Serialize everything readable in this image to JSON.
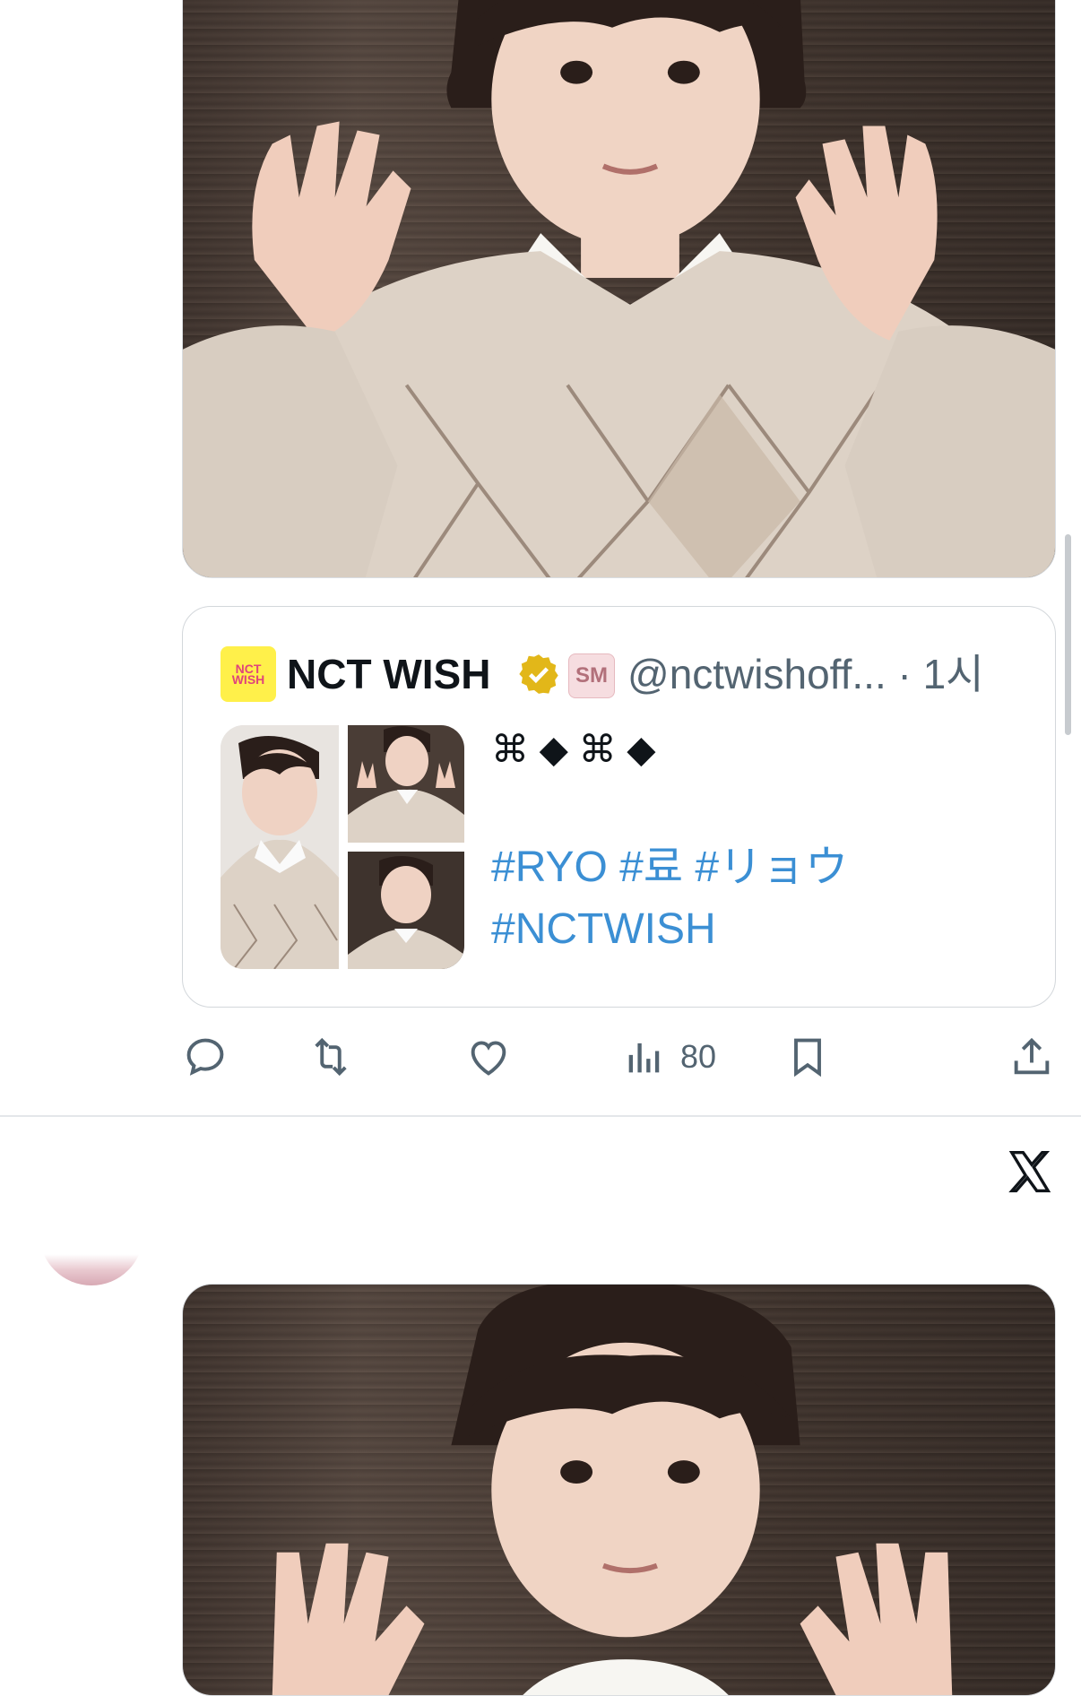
{
  "quoted_post": {
    "display_name": "NCT WISH",
    "handle_time": "@nctwishoff... · 1시",
    "avatar_text": "NCT WISH",
    "affiliation_text": "SM",
    "text_line1": "⌘ ◆ ⌘ ◆",
    "hashtags_line1": "#RYO #료 #リョウ",
    "hashtags_line2": "#NCTWISH"
  },
  "actions": {
    "views_count": "80"
  },
  "colors": {
    "link": "#1d9bf0",
    "secondary_text": "#536471",
    "verified_gold": "#e2b719"
  },
  "icons": [
    "reply-icon",
    "repost-icon",
    "like-icon",
    "views-icon",
    "bookmark-icon",
    "share-icon",
    "x-logo-icon",
    "verified-badge-icon"
  ]
}
